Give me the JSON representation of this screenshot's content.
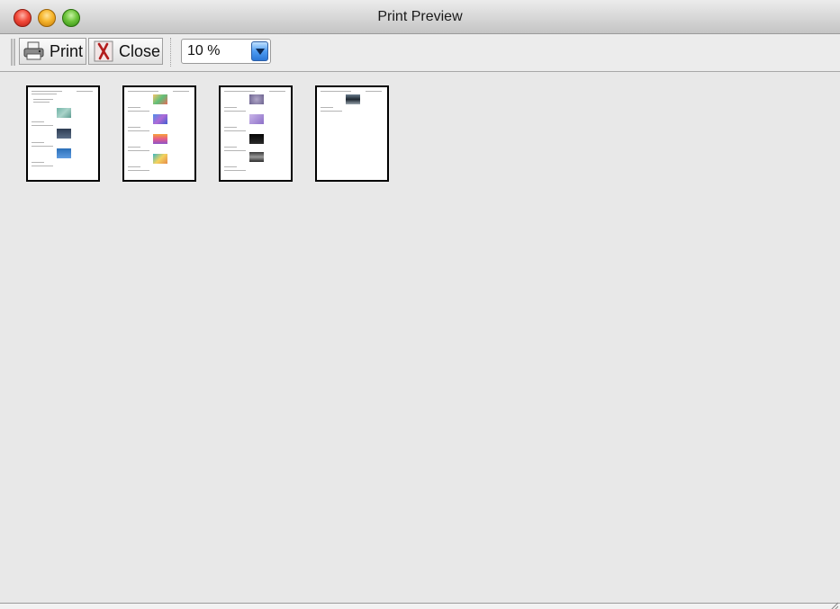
{
  "window": {
    "title": "Print Preview"
  },
  "toolbar": {
    "print_label": "Print",
    "close_label": "Close",
    "zoom_value": "10 %"
  },
  "pages": [
    {
      "thumbnails": [
        "teal-mosaic",
        "dark-blue-photo",
        "blue-photo"
      ]
    },
    {
      "thumbnails": [
        "green-gradient",
        "blue-purple-gradient",
        "orange-purple-gradient",
        "teal-yellow-gradient"
      ]
    },
    {
      "thumbnails": [
        "purple-texture",
        "purple-light",
        "black-photo",
        "dark-gray-photo"
      ]
    },
    {
      "thumbnails": [
        "dark-landscape"
      ]
    }
  ],
  "colors": {
    "window_bg": "#e8e8e8",
    "zoom_arrow": "#3a86e6"
  }
}
